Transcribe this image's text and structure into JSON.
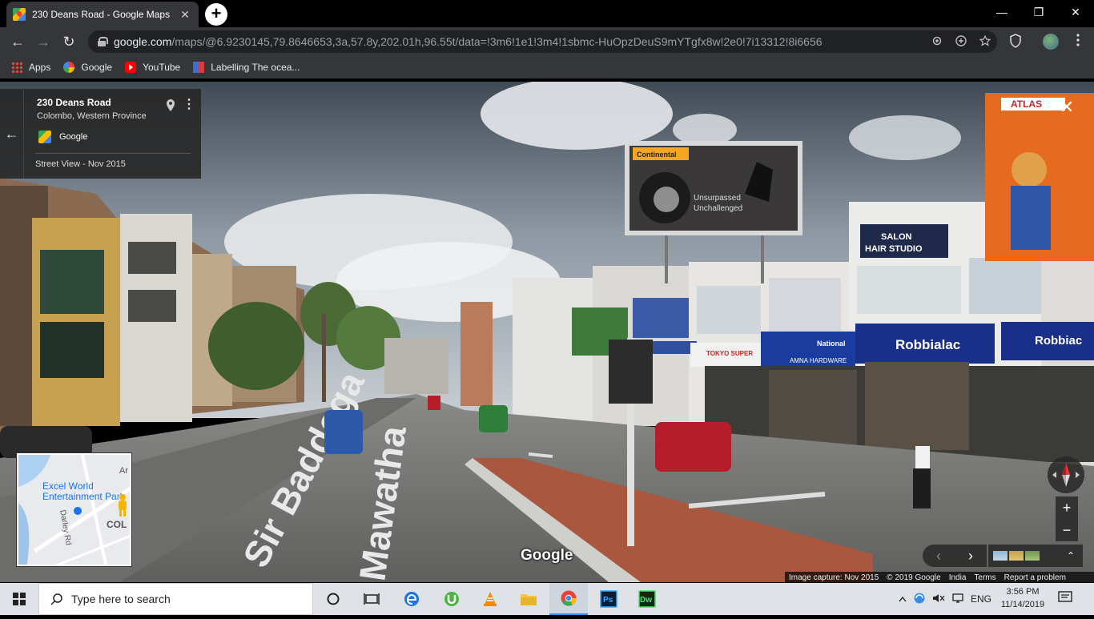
{
  "browser": {
    "tab_title": "230 Deans Road - Google Maps",
    "tab_close": "✕",
    "newtab": "+",
    "url_host": "google.com",
    "url_path": "/maps/@6.9230145,79.8646653,3a,57.8y,202.01h,96.55t/data=!3m6!1e1!3m4!1sbmc-HuOpzDeuS9mYTgfx8w!2e0!7i13312!8i6656",
    "window_minimize": "—",
    "window_restore": "❐",
    "window_close": "✕",
    "back": "←",
    "forward": "→",
    "reload": "↻"
  },
  "bookmarks": [
    {
      "label": "Apps"
    },
    {
      "label": "Google"
    },
    {
      "label": "YouTube"
    },
    {
      "label": "Labelling The ocea..."
    }
  ],
  "infocard": {
    "address": "230 Deans Road",
    "city": "Colombo, Western Province",
    "provider": "Google",
    "date": "Street View - Nov 2015",
    "back_arrow": "←",
    "more": "⋮"
  },
  "streetview": {
    "close": "✕",
    "watermark": "Google",
    "zoom_in": "+",
    "zoom_out": "−",
    "prev": "‹",
    "next": "›",
    "expand": "⌃"
  },
  "billboards": {
    "tire_brand": "Continental",
    "tire_line1": "Unsurpassed",
    "tire_line2": "Unchallenged",
    "salon": "SALON",
    "salon2": "HAIR STUDIO",
    "robbialac1": "Robbialac",
    "robbialac2": "Robbiac",
    "tokyo": "TOKYO SUPER",
    "national": "National",
    "amna": "AMNA HARDWARE",
    "atlas": "ATLAS"
  },
  "road_text": {
    "line1": "Sir Baddega",
    "line2": "Mawatha"
  },
  "minimap": {
    "poi1": "Excel World",
    "poi2": "Entertainment Park",
    "street": "Darley Rd",
    "area": "COL",
    "edge": "Ar"
  },
  "footer": {
    "capture": "Image capture: Nov 2015",
    "copyright": "© 2019 Google",
    "country": "India",
    "terms": "Terms",
    "report": "Report a problem"
  },
  "taskbar": {
    "search_placeholder": "Type here to search",
    "lang": "ENG",
    "time": "3:56 PM",
    "date": "11/14/2019"
  },
  "colors": {
    "chrome_dark": "#35363a",
    "omnibox": "#202124",
    "taskbar": "#dfe3e8",
    "accent": "#1a73e8"
  }
}
